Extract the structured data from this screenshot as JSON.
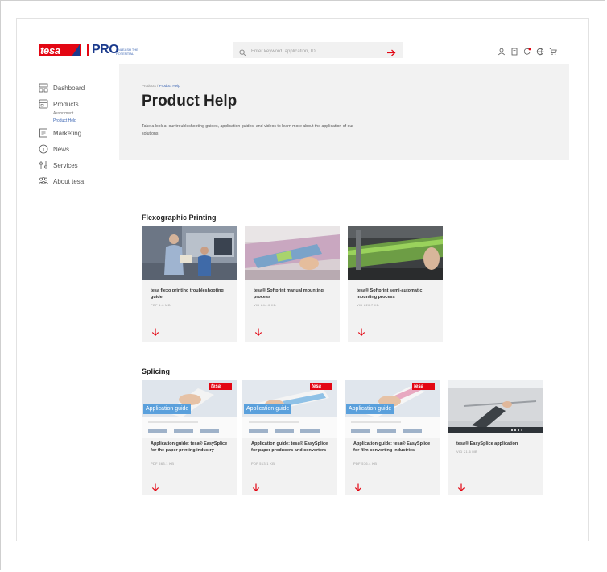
{
  "header": {
    "logo_text": "tesa",
    "pro_text": "PRO",
    "pro_tagline": "Unleash the potential",
    "search_placeholder": "Enter keyword, application, ID ..."
  },
  "sidebar": {
    "items": [
      {
        "label": "Dashboard"
      },
      {
        "label": "Products"
      },
      {
        "label": "Marketing"
      },
      {
        "label": "News"
      },
      {
        "label": "Services"
      },
      {
        "label": "About tesa"
      }
    ],
    "sub_items": [
      {
        "label": "Assortment"
      },
      {
        "label": "Product Help"
      }
    ]
  },
  "hero": {
    "breadcrumb_root": "Products",
    "breadcrumb_sep": "/",
    "breadcrumb_current": "Product Help",
    "title": "Product Help",
    "description": "Take a look at our troubleshooting guides, application guides, and videos to learn more about the application of our solutions"
  },
  "sections": [
    {
      "title": "Flexographic Printing",
      "cards": [
        {
          "title": "tesa flexo printing troubleshooting guide",
          "meta": "PDF 1.6 MB"
        },
        {
          "title": "tesa® Softprint manual mounting process",
          "meta": "VID 844.0 KB"
        },
        {
          "title": "tesa® Softprint semi-automatic mounting process",
          "meta": "VID 820.7 KB"
        }
      ]
    },
    {
      "title": "Splicing",
      "cards": [
        {
          "title": "Application guide: tesa® EasySplice for the paper printing industry",
          "meta": "PDF 563.1 KB",
          "badge": "Application guide"
        },
        {
          "title": "Application guide: tesa® EasySplice for paper producers and converters",
          "meta": "PDF 513.1 KB",
          "badge": "Application guide"
        },
        {
          "title": "Application guide: tesa® EasySplice for film converting industries",
          "meta": "PDF 576.4 KB",
          "badge": "Application guide"
        },
        {
          "title": "tesa® EasySplice application",
          "meta": "VID 21.6 MB"
        }
      ]
    }
  ],
  "colors": {
    "brand_red": "#e30613",
    "brand_blue": "#1a3a8c",
    "accent_blue": "#3d66b3"
  }
}
